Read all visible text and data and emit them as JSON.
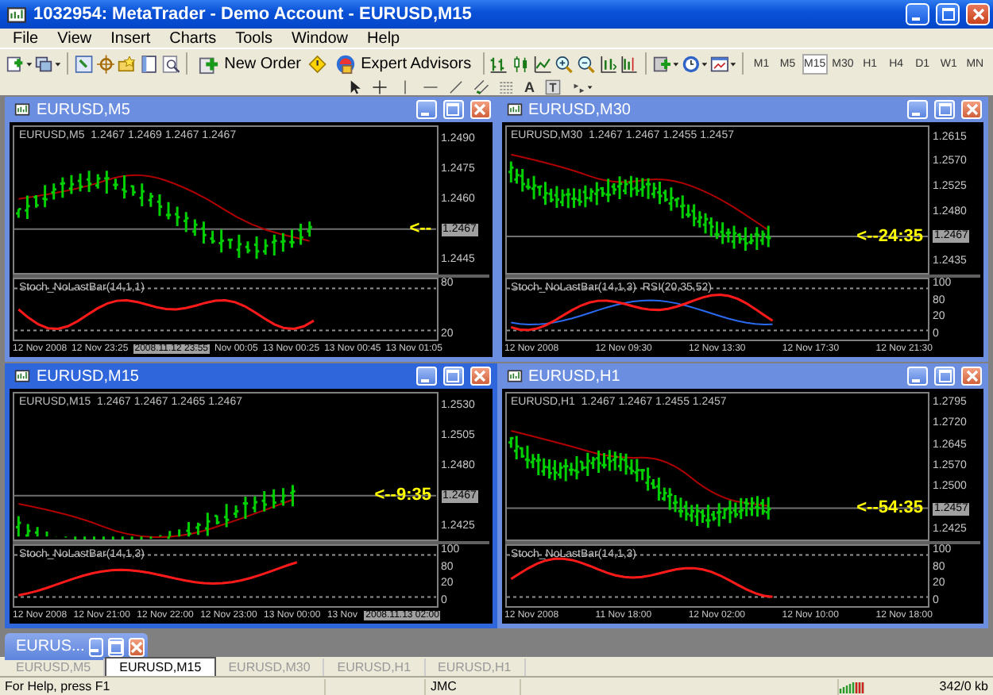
{
  "window": {
    "title": "1032954: MetaTrader - Demo Account - EURUSD,M15"
  },
  "menu": [
    "File",
    "View",
    "Insert",
    "Charts",
    "Tools",
    "Window",
    "Help"
  ],
  "toolbar": {
    "new_order": "New Order",
    "expert_advisors": "Expert Advisors",
    "timeframes": [
      {
        "label": "M1",
        "selected": false
      },
      {
        "label": "M5",
        "selected": false
      },
      {
        "label": "M15",
        "selected": true
      },
      {
        "label": "M30",
        "selected": false
      },
      {
        "label": "H1",
        "selected": false
      },
      {
        "label": "H4",
        "selected": false
      },
      {
        "label": "D1",
        "selected": false
      },
      {
        "label": "W1",
        "selected": false
      },
      {
        "label": "MN",
        "selected": false
      }
    ],
    "text_tool": "A"
  },
  "charts": [
    {
      "title": "EURUSD,M5",
      "active": false,
      "header": "EURUSD,M5  1.2467 1.2469 1.2467 1.2467",
      "timer": "<--",
      "price_labels": [
        {
          "text": "1.2490",
          "kind": "tick"
        },
        {
          "text": "1.2475",
          "kind": "tick"
        },
        {
          "text": "1.2460",
          "kind": "tick"
        },
        {
          "text": "1.2467",
          "kind": "current"
        },
        {
          "text": "1.2445",
          "kind": "tick"
        }
      ],
      "indicator_label": "Stoch_NoLastBar(14,1,1)",
      "indicator_levels": [
        "80",
        "20"
      ],
      "time_labels": [
        {
          "text": "12 Nov 2008",
          "kind": "tick"
        },
        {
          "text": "12 Nov 23:25",
          "kind": "tick"
        },
        {
          "text": "2008.11.12 23:55",
          "kind": "cursor"
        },
        {
          "text": "Nov 00:05",
          "kind": "tick"
        },
        {
          "text": "13 Nov 00:25",
          "kind": "tick"
        },
        {
          "text": "13 Nov 00:45",
          "kind": "tick"
        },
        {
          "text": "13 Nov 01:05",
          "kind": "tick"
        }
      ]
    },
    {
      "title": "EURUSD,M30",
      "active": false,
      "header": "EURUSD,M30  1.2467 1.2467 1.2455 1.2457",
      "timer": "<--24:35",
      "price_labels": [
        {
          "text": "1.2615",
          "kind": "tick"
        },
        {
          "text": "1.2570",
          "kind": "tick"
        },
        {
          "text": "1.2525",
          "kind": "tick"
        },
        {
          "text": "1.2480",
          "kind": "tick"
        },
        {
          "text": "1.2467",
          "kind": "current"
        },
        {
          "text": "1.2435",
          "kind": "tick"
        }
      ],
      "indicator_label": "Stoch_NoLastBar(14,1,3)  RSI(20,35,52)",
      "indicator_levels": [
        "100",
        "80",
        "20",
        "0"
      ],
      "time_labels": [
        {
          "text": "12 Nov 2008",
          "kind": "tick"
        },
        {
          "text": "12 Nov 09:30",
          "kind": "tick"
        },
        {
          "text": "12 Nov 13:30",
          "kind": "tick"
        },
        {
          "text": "12 Nov 17:30",
          "kind": "tick"
        },
        {
          "text": "12 Nov 21:30",
          "kind": "tick"
        }
      ]
    },
    {
      "title": "EURUSD,M15",
      "active": true,
      "header": "EURUSD,M15  1.2467 1.2467 1.2465 1.2467",
      "timer": "<--9:35",
      "price_labels": [
        {
          "text": "1.2530",
          "kind": "tick"
        },
        {
          "text": "1.2505",
          "kind": "tick"
        },
        {
          "text": "1.2480",
          "kind": "tick"
        },
        {
          "text": "1.2467",
          "kind": "current"
        },
        {
          "text": "1.2425",
          "kind": "tick"
        }
      ],
      "indicator_label": "Stoch_NoLastBar(14,1,3)",
      "indicator_levels": [
        "100",
        "80",
        "20",
        "0"
      ],
      "time_labels": [
        {
          "text": "12 Nov 2008",
          "kind": "tick"
        },
        {
          "text": "12 Nov 21:00",
          "kind": "tick"
        },
        {
          "text": "12 Nov 22:00",
          "kind": "tick"
        },
        {
          "text": "12 Nov 23:00",
          "kind": "tick"
        },
        {
          "text": "13 Nov 00:00",
          "kind": "tick"
        },
        {
          "text": "13 Nov",
          "kind": "tick"
        },
        {
          "text": "2008.11.13 02:00",
          "kind": "cursor"
        }
      ]
    },
    {
      "title": "EURUSD,H1",
      "active": false,
      "header": "EURUSD,H1  1.2467 1.2467 1.2455 1.2457",
      "timer": "<--54:35",
      "price_labels": [
        {
          "text": "1.2795",
          "kind": "tick"
        },
        {
          "text": "1.2720",
          "kind": "tick"
        },
        {
          "text": "1.2645",
          "kind": "tick"
        },
        {
          "text": "1.2570",
          "kind": "tick"
        },
        {
          "text": "1.2500",
          "kind": "tick"
        },
        {
          "text": "1.2457",
          "kind": "current"
        },
        {
          "text": "1.2425",
          "kind": "tick"
        }
      ],
      "indicator_label": "Stoch_NoLastBar(14,1,3)",
      "indicator_levels": [
        "100",
        "80",
        "20",
        "0"
      ],
      "time_labels": [
        {
          "text": "12 Nov 2008",
          "kind": "tick"
        },
        {
          "text": "11 Nov 18:00",
          "kind": "tick"
        },
        {
          "text": "12 Nov 02:00",
          "kind": "tick"
        },
        {
          "text": "12 Nov 10:00",
          "kind": "tick"
        },
        {
          "text": "12 Nov 18:00",
          "kind": "tick"
        }
      ]
    }
  ],
  "minimized": {
    "title": "EURUS..."
  },
  "tabs": [
    {
      "label": "EURUSD,M5",
      "selected": false
    },
    {
      "label": "EURUSD,M15",
      "selected": true
    },
    {
      "label": "EURUSD,M30",
      "selected": false
    },
    {
      "label": "EURUSD,H1",
      "selected": false
    },
    {
      "label": "EURUSD,H1",
      "selected": false
    }
  ],
  "status_bar": {
    "help": "For Help, press F1",
    "profile": "JMC",
    "traffic": "342/0 kb"
  }
}
